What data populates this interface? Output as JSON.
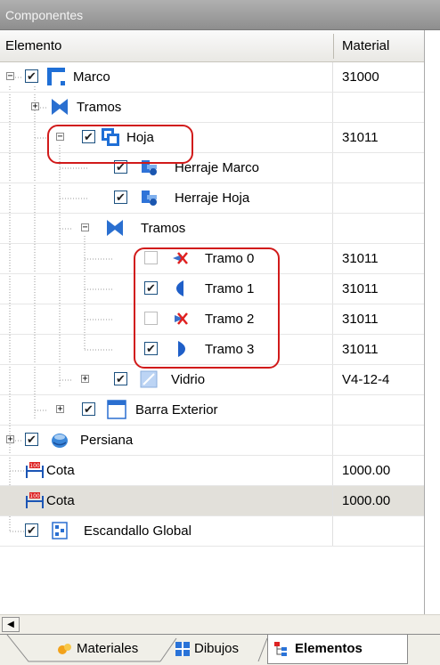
{
  "panel": {
    "title": "Componentes"
  },
  "columns": {
    "element": "Elemento",
    "material": "Material"
  },
  "rows": [
    {
      "label": "Marco",
      "material": "31000",
      "checked": true,
      "expander": "minus",
      "icon": "frame-icon"
    },
    {
      "label": "Tramos",
      "material": "",
      "checked": null,
      "expander": "plus",
      "icon": "tramos-icon"
    },
    {
      "label": "Hoja",
      "material": "31011",
      "checked": true,
      "expander": "minus",
      "icon": "sash-icon"
    },
    {
      "label": "Herraje Marco",
      "material": "",
      "checked": true,
      "expander": null,
      "icon": "hardware-icon"
    },
    {
      "label": "Herraje Hoja",
      "material": "",
      "checked": true,
      "expander": null,
      "icon": "hardware-icon"
    },
    {
      "label": "Tramos",
      "material": "",
      "checked": null,
      "expander": "minus",
      "icon": "tramos-icon"
    },
    {
      "label": "Tramo 0",
      "material": "31011",
      "checked": false,
      "expander": null,
      "icon": "tramo-disabled-icon"
    },
    {
      "label": "Tramo 1",
      "material": "31011",
      "checked": true,
      "expander": null,
      "icon": "tramo-left-icon"
    },
    {
      "label": "Tramo 2",
      "material": "31011",
      "checked": false,
      "expander": null,
      "icon": "tramo-disabled-icon"
    },
    {
      "label": "Tramo 3",
      "material": "31011",
      "checked": true,
      "expander": null,
      "icon": "tramo-right-icon"
    },
    {
      "label": "Vidrio",
      "material": "V4-12-4",
      "checked": true,
      "expander": "plus",
      "icon": "glass-icon"
    },
    {
      "label": "Barra Exterior",
      "material": "",
      "checked": true,
      "expander": "plus",
      "icon": "bar-icon"
    },
    {
      "label": "Persiana",
      "material": "",
      "checked": true,
      "expander": "plus",
      "icon": "blind-icon"
    },
    {
      "label": "Cota",
      "material": "1000.00",
      "checked": null,
      "expander": null,
      "icon": "dimension-icon"
    },
    {
      "label": "Cota",
      "material": "1000.00",
      "checked": null,
      "expander": null,
      "icon": "dimension-icon",
      "selected": true
    },
    {
      "label": "Escandallo Global",
      "material": "",
      "checked": true,
      "expander": null,
      "icon": "breakdown-icon"
    }
  ],
  "tabs": [
    {
      "label": "Materiales",
      "icon": "materials-icon",
      "active": false
    },
    {
      "label": "Dibujos",
      "icon": "drawings-icon",
      "active": false
    },
    {
      "label": "Elementos",
      "icon": "elements-icon",
      "active": true
    }
  ],
  "colors": {
    "highlight": "#d11a1a",
    "selection": "#e2e0da",
    "checkbox_border": "#1c5180"
  }
}
